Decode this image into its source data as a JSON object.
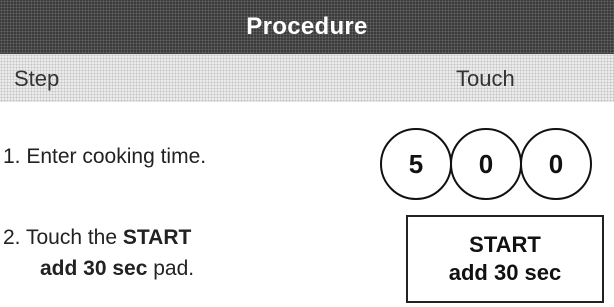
{
  "header": {
    "title": "Procedure"
  },
  "columns": {
    "step": "Step",
    "touch": "Touch"
  },
  "steps": [
    {
      "text": "1. Enter cooking time.",
      "keys": [
        "5",
        "0",
        "0"
      ]
    },
    {
      "line1_prefix": "2. Touch the ",
      "line1_bold": "START",
      "line2_bold": "add 30 sec",
      "line2_suffix": " pad.",
      "pad_line1": "START",
      "pad_line2": "add 30 sec"
    }
  ],
  "colors": {
    "banner": "#333333",
    "subheader": "#ededed",
    "text": "#222222"
  }
}
